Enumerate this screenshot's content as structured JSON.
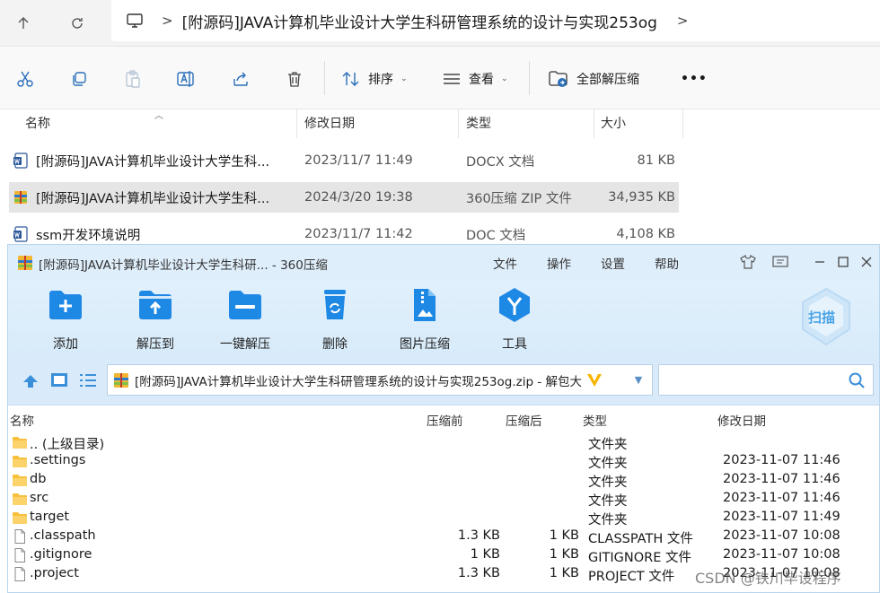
{
  "explorer": {
    "address": {
      "crumb": "[附源码]JAVA计算机毕业设计大学生科研管理系统的设计与实现253og",
      "sep": ">",
      "sep_end": ">"
    },
    "toolbar": {
      "sort_label": "排序",
      "view_label": "查看",
      "extract_all_label": "全部解压缩",
      "more_label": "•••"
    },
    "columns": {
      "name": "名称",
      "modified": "修改日期",
      "type": "类型",
      "size": "大小"
    },
    "files": [
      {
        "name": "[附源码]JAVA计算机毕业设计大学生科...",
        "modified": "2023/11/7 11:49",
        "type": "DOCX 文档",
        "size": "81 KB",
        "icon": "word-doc-icon"
      },
      {
        "name": "[附源码]JAVA计算机毕业设计大学生科...",
        "modified": "2024/3/20 19:38",
        "type": "360压缩 ZIP 文件",
        "size": "34,935 KB",
        "icon": "zip-archive-icon"
      },
      {
        "name": "ssm开发环境说明",
        "modified": "2023/11/7 11:42",
        "type": "DOC 文档",
        "size": "4,108 KB",
        "icon": "word-doc-icon"
      }
    ]
  },
  "zip_window": {
    "title": "[附源码]JAVA计算机毕业设计大学生科研... - 360压缩",
    "menu": [
      "文件",
      "操作",
      "设置",
      "帮助"
    ],
    "tools": [
      {
        "label": "添加",
        "icon": "add-folder-icon"
      },
      {
        "label": "解压到",
        "icon": "extract-to-icon"
      },
      {
        "label": "一键解压",
        "icon": "one-click-extract-icon"
      },
      {
        "label": "删除",
        "icon": "recycle-bin-icon"
      },
      {
        "label": "图片压缩",
        "icon": "image-compress-icon"
      },
      {
        "label": "工具",
        "icon": "tools-icon"
      }
    ],
    "scan_label": "扫描",
    "path": "[附源码]JAVA计算机毕业设计大学生科研管理系统的设计与实现253og.zip - 解包大",
    "columns": {
      "name": "名称",
      "compressed_before": "压缩前",
      "compressed_after": "压缩后",
      "type": "类型",
      "modified": "修改日期"
    },
    "entries": [
      {
        "name": ".. (上级目录)",
        "before": "",
        "after": "",
        "type": "文件夹",
        "modified": "",
        "icon": "folder-icon"
      },
      {
        "name": ".settings",
        "before": "",
        "after": "",
        "type": "文件夹",
        "modified": "2023-11-07 11:46",
        "icon": "folder-icon"
      },
      {
        "name": "db",
        "before": "",
        "after": "",
        "type": "文件夹",
        "modified": "2023-11-07 11:46",
        "icon": "folder-icon"
      },
      {
        "name": "src",
        "before": "",
        "after": "",
        "type": "文件夹",
        "modified": "2023-11-07 11:46",
        "icon": "folder-icon"
      },
      {
        "name": "target",
        "before": "",
        "after": "",
        "type": "文件夹",
        "modified": "2023-11-07 11:49",
        "icon": "folder-icon"
      },
      {
        "name": ".classpath",
        "before": "1.3 KB",
        "after": "1 KB",
        "type": "CLASSPATH 文件",
        "modified": "2023-11-07 10:08",
        "icon": "file-icon"
      },
      {
        "name": ".gitignore",
        "before": "1 KB",
        "after": "1 KB",
        "type": "GITIGNORE 文件",
        "modified": "2023-11-07 10:08",
        "icon": "file-icon"
      },
      {
        "name": ".project",
        "before": "1.3 KB",
        "after": "1 KB",
        "type": "PROJECT 文件",
        "modified": "2023-11-07 10:08",
        "icon": "file-icon"
      }
    ]
  },
  "watermark": "CSDN @铁川毕设程序",
  "colors": {
    "zip_toolbar_bg": "#dcedfb",
    "accent_blue": "#1e88e5",
    "folder_yellow": "#f8c03c",
    "selection_gray": "#e5e5e5"
  }
}
